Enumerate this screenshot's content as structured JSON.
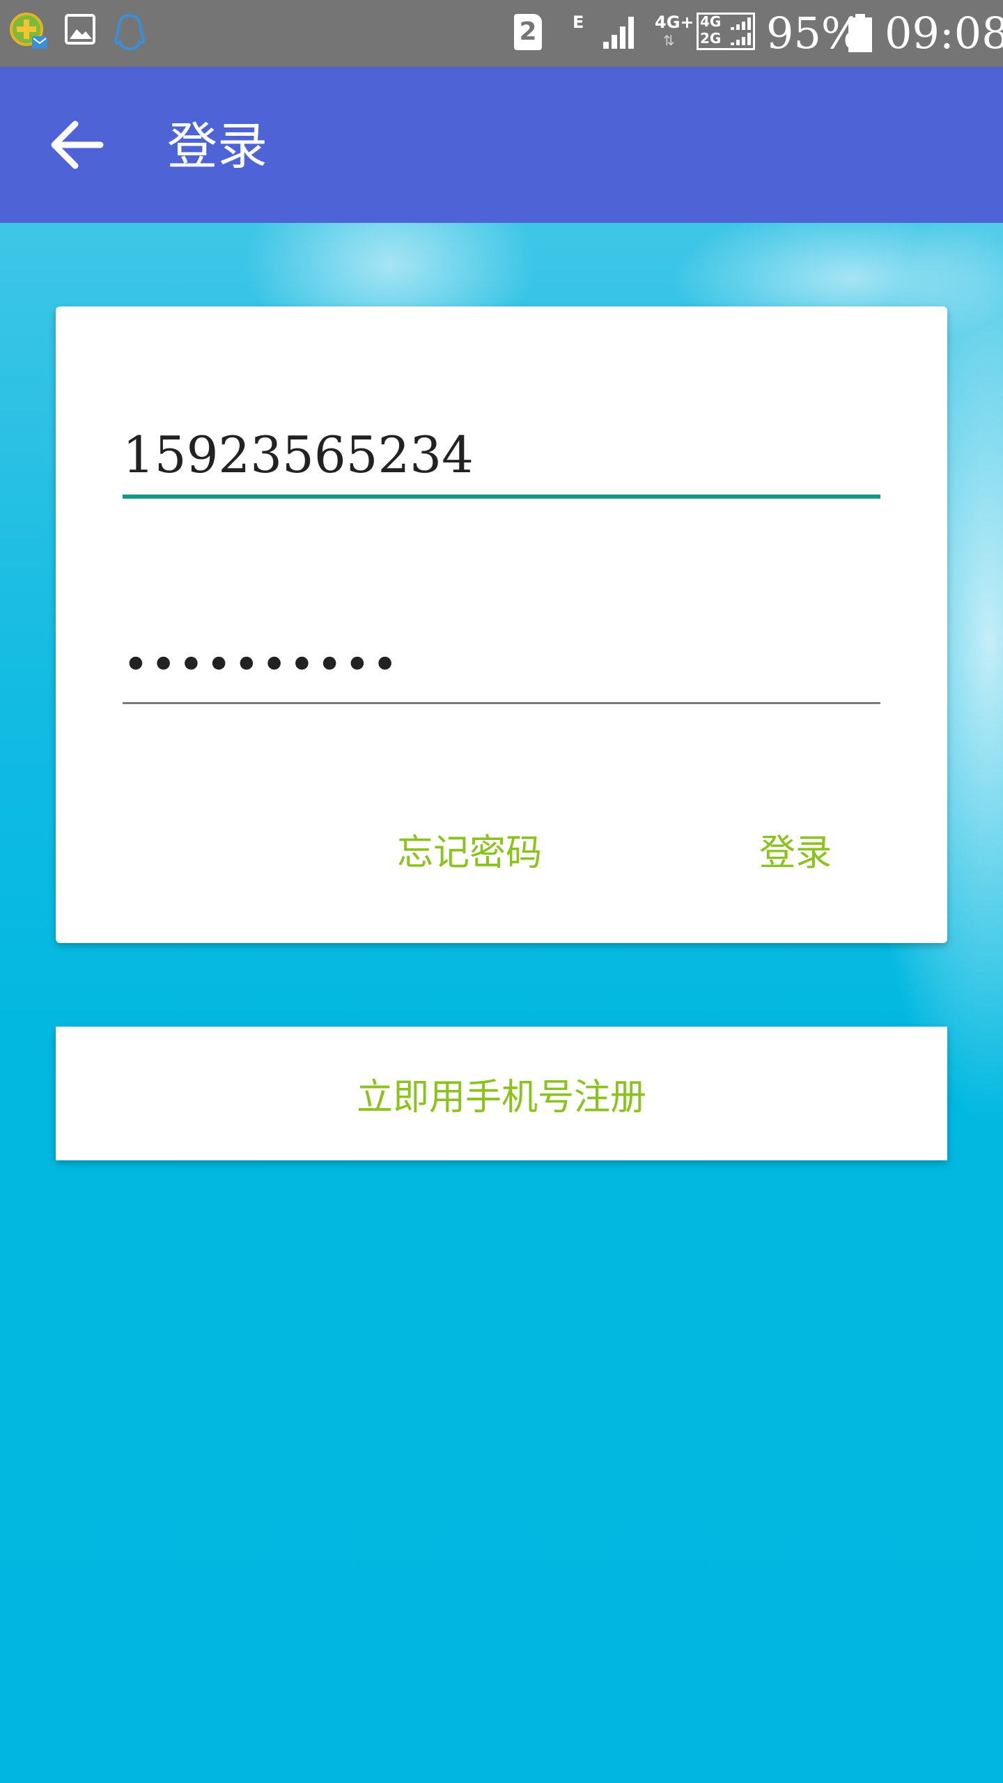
{
  "status_bar": {
    "sim_slot": "2",
    "network_e": "E",
    "network_4g_plus": "4G+",
    "network_4g": "4G",
    "network_2g": "2G",
    "battery": "95%",
    "time": "09:08",
    "icons": [
      "360-security-icon",
      "gallery-icon",
      "qq-icon",
      "sim-2-icon",
      "signal-icon",
      "battery-icon"
    ]
  },
  "app_bar": {
    "back_icon": "arrow-left-icon",
    "title": "登录",
    "color": "#4e64d6"
  },
  "login_form": {
    "phone_value": "15923565234",
    "password_value": "••••••••••",
    "forgot_label": "忘记密码",
    "login_label": "登录",
    "accent_color": "#8cc21f",
    "active_underline_color": "#17968a"
  },
  "register": {
    "label": "立即用手机号注册"
  }
}
